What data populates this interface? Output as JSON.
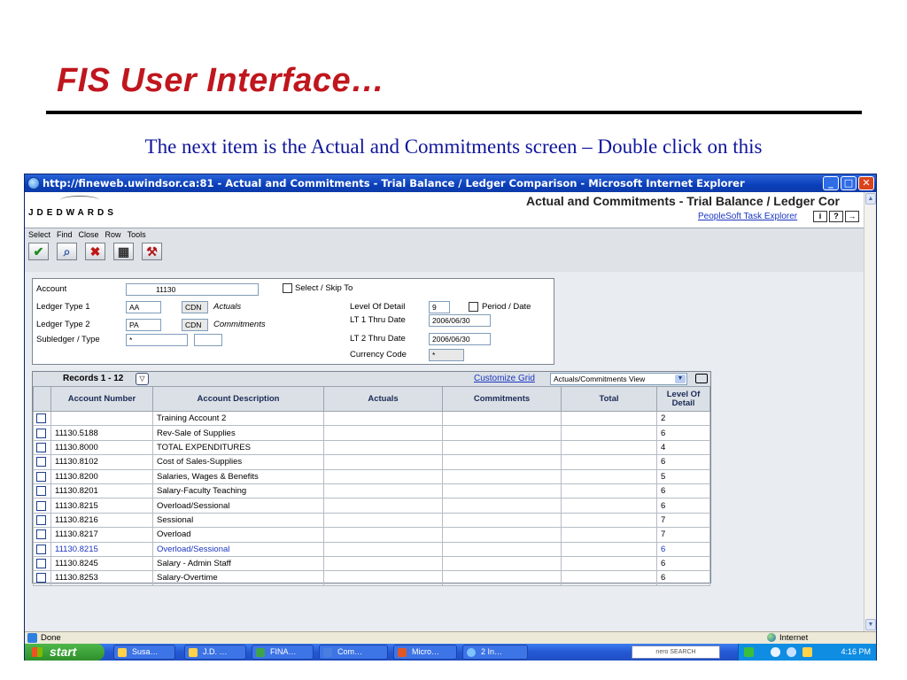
{
  "slide": {
    "title": "FIS User Interface…",
    "caption": "The next item is the Actual and Commitments screen – Double click on this"
  },
  "browser": {
    "title": "http://fineweb.uwindsor.ca:81 - Actual and Commitments - Trial Balance / Ledger Comparison - Microsoft Internet Explorer",
    "status": "Done",
    "zone": "Internet"
  },
  "app": {
    "logo": "JDEDWARDS",
    "title": "Actual and Commitments - Trial Balance / Ledger Cor",
    "peoplesoft_link": "PeopleSoft Task Explorer",
    "help_icons": [
      "i",
      "?",
      "→"
    ],
    "menu": [
      "Select",
      "Find",
      "Close",
      "Row",
      "Tools"
    ]
  },
  "criteria": {
    "account_label": "Account",
    "account_value": "11130",
    "select_skip_label": "Select / Skip To",
    "ledger_type1_label": "Ledger Type 1",
    "ledger_type1_value": "AA",
    "ledger_type1_cur": "CDN",
    "ledger_type1_desc": "Actuals",
    "ledger_type2_label": "Ledger Type 2",
    "ledger_type2_value": "PA",
    "ledger_type2_cur": "CDN",
    "ledger_type2_desc": "Commitments",
    "subledger_label": "Subledger / Type",
    "subledger_value": "*",
    "level_label": "Level Of Detail",
    "level_value": "9",
    "period_label": "Period / Date",
    "lt1_label": "LT 1 Thru Date",
    "lt1_value": "2006/06/30",
    "lt2_label": "LT 2 Thru Date",
    "lt2_value": "2006/06/30",
    "currency_label": "Currency Code",
    "currency_value": "*"
  },
  "grid": {
    "records_label": "Records 1 - 12",
    "customize_label": "Customize Grid",
    "view_value": "Actuals/Commitments View",
    "columns": [
      "Account Number",
      "Account Description",
      "Actuals",
      "Commitments",
      "Total",
      "Level Of Detail"
    ],
    "rows": [
      {
        "account": "",
        "description": "Training Account 2",
        "actuals": "",
        "commitments": "",
        "total": "",
        "level": "2"
      },
      {
        "account": "11130.5188",
        "description": "Rev-Sale of Supplies",
        "actuals": "",
        "commitments": "",
        "total": "",
        "level": "6"
      },
      {
        "account": "11130.8000",
        "description": "TOTAL EXPENDITURES",
        "actuals": "",
        "commitments": "",
        "total": "",
        "level": "4"
      },
      {
        "account": "11130.8102",
        "description": "Cost of Sales-Supplies",
        "actuals": "",
        "commitments": "",
        "total": "",
        "level": "6"
      },
      {
        "account": "11130.8200",
        "description": "Salaries, Wages & Benefits",
        "actuals": "",
        "commitments": "",
        "total": "",
        "level": "5"
      },
      {
        "account": "11130.8201",
        "description": "Salary-Faculty Teaching",
        "actuals": "",
        "commitments": "",
        "total": "",
        "level": "6"
      },
      {
        "account": "11130.8215",
        "description": "Overload/Sessional",
        "actuals": "",
        "commitments": "",
        "total": "",
        "level": "6"
      },
      {
        "account": "11130.8216",
        "description": "Sessional",
        "actuals": "",
        "commitments": "",
        "total": "",
        "level": "7"
      },
      {
        "account": "11130.8217",
        "description": "Overload",
        "actuals": "",
        "commitments": "",
        "total": "",
        "level": "7"
      },
      {
        "account": "11130.8215",
        "description": "Overload/Sessional",
        "actuals": "",
        "commitments": "",
        "total": "",
        "level": "6"
      },
      {
        "account": "11130.8245",
        "description": "Salary - Admin Staff",
        "actuals": "",
        "commitments": "",
        "total": "",
        "level": "6"
      },
      {
        "account": "11130.8253",
        "description": "Salary-Overtime",
        "actuals": "",
        "commitments": "",
        "total": "",
        "level": "6"
      }
    ]
  },
  "taskbar": {
    "start": "start",
    "tasks": [
      "Susa…",
      "J.D. …",
      "FINA…",
      "Com…",
      "Micro…",
      "2 In…"
    ],
    "nero": "nero SEARCH",
    "clock": "4:16 PM"
  }
}
